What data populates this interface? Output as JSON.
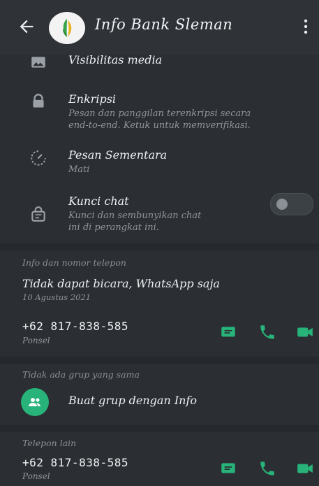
{
  "header": {
    "title": "Info Bank Sleman"
  },
  "media": {
    "label": "Visibilitas media"
  },
  "encryption": {
    "label": "Enkripsi",
    "line1": "Pesan dan panggilan terenkripsi secara",
    "line2": "end-to-end. Ketuk untuk memverifikasi."
  },
  "disappearing": {
    "label": "Pesan Sementara",
    "value": "Mati"
  },
  "chat_lock": {
    "label": "Kunci chat",
    "line1": "Kunci dan sembunyikan chat",
    "line2": "ini di perangkat ini.",
    "enabled": false
  },
  "about": {
    "section": "Info dan nomor telepon",
    "status": "Tidak dapat bicara, WhatsApp saja",
    "date": "10 Agustus 2021",
    "phone": "+62 817-838-585",
    "phone_type": "Ponsel"
  },
  "groups": {
    "section": "Tidak ada grup yang sama",
    "create_label": "Buat grup dengan Info"
  },
  "other_phone": {
    "section": "Telepon lain",
    "phone": "+62 817-838-585",
    "phone_type": "Ponsel"
  },
  "colors": {
    "accent": "#27b37a",
    "background": "#2b2e33"
  },
  "icons": [
    "back-arrow-icon",
    "logo-icon",
    "more-vert-icon",
    "image-icon",
    "lock-icon",
    "timer-icon",
    "chat-lock-icon",
    "message-icon",
    "phone-icon",
    "video-icon",
    "group-add-icon"
  ]
}
